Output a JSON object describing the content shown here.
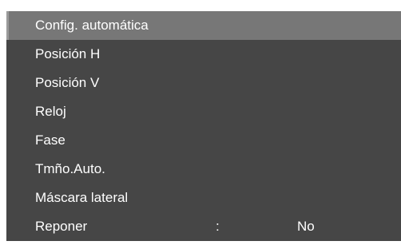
{
  "menu": {
    "items": [
      {
        "label": "Config. automática",
        "selected": true
      },
      {
        "label": "Posición H"
      },
      {
        "label": "Posición V"
      },
      {
        "label": "Reloj"
      },
      {
        "label": "Fase"
      },
      {
        "label": "Tmño.Auto."
      },
      {
        "label": "Máscara lateral"
      },
      {
        "label": "Reponer",
        "separator": ":",
        "value": "No"
      }
    ]
  }
}
